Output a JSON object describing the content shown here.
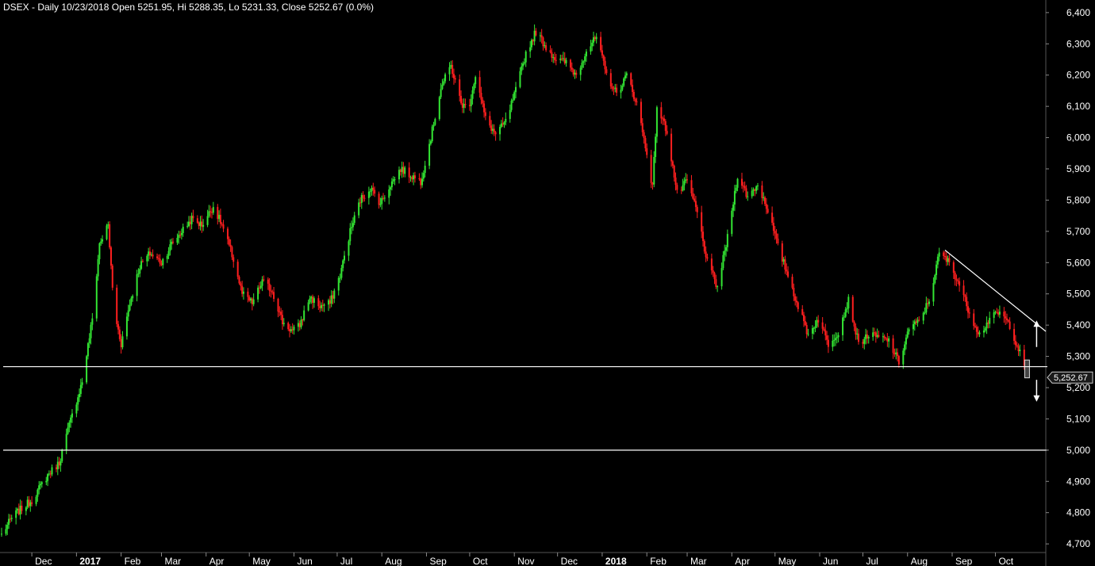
{
  "title": "DSEX - Daily 10/23/2018 Open 5251.95, Hi 5288.35, Lo 5231.33, Close 5252.67 (0.0%)",
  "colors": {
    "background": "#000000",
    "up_candle": "#33e633",
    "down_candle": "#ff1f1f",
    "lines": "#ffffff",
    "axis_text": "#ffffff"
  },
  "chart_data": {
    "type": "candlestick",
    "symbol": "DSEX",
    "interval": "Daily",
    "last_bar": {
      "date": "10/23/2018",
      "open": 5251.95,
      "high": 5288.35,
      "low": 5231.33,
      "close": 5252.67,
      "change": "0.0%"
    },
    "price_label": "5,252.67",
    "ylim": [
      4680,
      6420
    ],
    "y_ticks": [
      4700,
      4800,
      4900,
      5000,
      5100,
      5200,
      5300,
      5400,
      5500,
      5600,
      5700,
      5800,
      5900,
      6000,
      6100,
      6200,
      6300,
      6400
    ],
    "y_tick_labels": [
      "4,700",
      "4,800",
      "4,900",
      "5,000",
      "5,100",
      "5,200",
      "5,300",
      "5,400",
      "5,500",
      "5,600",
      "5,700",
      "5,800",
      "5,900",
      "6,000",
      "6,100",
      "6,200",
      "6,300",
      "6,400"
    ],
    "x_range": [
      "2016-11-10",
      "2018-11-05"
    ],
    "x_labels": [
      {
        "label": "Dec",
        "date": "2016-12-01",
        "bold": false
      },
      {
        "label": "2017",
        "date": "2017-01-01",
        "bold": true
      },
      {
        "label": "Feb",
        "date": "2017-02-01",
        "bold": false
      },
      {
        "label": "Mar",
        "date": "2017-03-01",
        "bold": false
      },
      {
        "label": "Apr",
        "date": "2017-04-01",
        "bold": false
      },
      {
        "label": "May",
        "date": "2017-05-01",
        "bold": false
      },
      {
        "label": "Jun",
        "date": "2017-06-01",
        "bold": false
      },
      {
        "label": "Jul",
        "date": "2017-07-01",
        "bold": false
      },
      {
        "label": "Aug",
        "date": "2017-08-01",
        "bold": false
      },
      {
        "label": "Sep",
        "date": "2017-09-01",
        "bold": false
      },
      {
        "label": "Oct",
        "date": "2017-10-01",
        "bold": false
      },
      {
        "label": "Nov",
        "date": "2017-11-01",
        "bold": false
      },
      {
        "label": "Dec",
        "date": "2017-12-01",
        "bold": false
      },
      {
        "label": "2018",
        "date": "2018-01-01",
        "bold": true
      },
      {
        "label": "Feb",
        "date": "2018-02-01",
        "bold": false
      },
      {
        "label": "Mar",
        "date": "2018-03-01",
        "bold": false
      },
      {
        "label": "Apr",
        "date": "2018-04-01",
        "bold": false
      },
      {
        "label": "May",
        "date": "2018-05-01",
        "bold": false
      },
      {
        "label": "Jun",
        "date": "2018-06-01",
        "bold": false
      },
      {
        "label": "Jul",
        "date": "2018-07-01",
        "bold": false
      },
      {
        "label": "Aug",
        "date": "2018-08-01",
        "bold": false
      },
      {
        "label": "Sep",
        "date": "2018-09-01",
        "bold": false
      },
      {
        "label": "Oct",
        "date": "2018-10-01",
        "bold": false
      }
    ],
    "close_path": [
      [
        "2016-11-10",
        4730
      ],
      [
        "2016-11-18",
        4790
      ],
      [
        "2016-12-01",
        4840
      ],
      [
        "2016-12-12",
        4920
      ],
      [
        "2016-12-20",
        4960
      ],
      [
        "2016-12-27",
        5080
      ],
      [
        "2017-01-05",
        5220
      ],
      [
        "2017-01-12",
        5420
      ],
      [
        "2017-01-17",
        5660
      ],
      [
        "2017-01-23",
        5720
      ],
      [
        "2017-01-27",
        5450
      ],
      [
        "2017-02-01",
        5340
      ],
      [
        "2017-02-07",
        5470
      ],
      [
        "2017-02-14",
        5590
      ],
      [
        "2017-02-21",
        5630
      ],
      [
        "2017-03-01",
        5600
      ],
      [
        "2017-03-08",
        5660
      ],
      [
        "2017-03-15",
        5700
      ],
      [
        "2017-03-22",
        5740
      ],
      [
        "2017-03-29",
        5720
      ],
      [
        "2017-04-06",
        5780
      ],
      [
        "2017-04-12",
        5720
      ],
      [
        "2017-04-20",
        5610
      ],
      [
        "2017-04-26",
        5500
      ],
      [
        "2017-05-03",
        5470
      ],
      [
        "2017-05-10",
        5540
      ],
      [
        "2017-05-17",
        5510
      ],
      [
        "2017-05-24",
        5410
      ],
      [
        "2017-05-31",
        5380
      ],
      [
        "2017-06-05",
        5400
      ],
      [
        "2017-06-12",
        5490
      ],
      [
        "2017-06-19",
        5460
      ],
      [
        "2017-06-26",
        5470
      ],
      [
        "2017-07-03",
        5560
      ],
      [
        "2017-07-10",
        5700
      ],
      [
        "2017-07-17",
        5800
      ],
      [
        "2017-07-24",
        5840
      ],
      [
        "2017-07-31",
        5790
      ],
      [
        "2017-08-07",
        5850
      ],
      [
        "2017-08-14",
        5900
      ],
      [
        "2017-08-21",
        5880
      ],
      [
        "2017-08-28",
        5860
      ],
      [
        "2017-09-04",
        6000
      ],
      [
        "2017-09-11",
        6160
      ],
      [
        "2017-09-18",
        6230
      ],
      [
        "2017-09-25",
        6110
      ],
      [
        "2017-09-30",
        6090
      ],
      [
        "2017-10-05",
        6200
      ],
      [
        "2017-10-12",
        6060
      ],
      [
        "2017-10-19",
        6010
      ],
      [
        "2017-10-26",
        6050
      ],
      [
        "2017-11-02",
        6150
      ],
      [
        "2017-11-09",
        6270
      ],
      [
        "2017-11-16",
        6340
      ],
      [
        "2017-11-23",
        6290
      ],
      [
        "2017-11-30",
        6250
      ],
      [
        "2017-12-07",
        6240
      ],
      [
        "2017-12-14",
        6200
      ],
      [
        "2017-12-21",
        6280
      ],
      [
        "2017-12-28",
        6320
      ],
      [
        "2018-01-04",
        6200
      ],
      [
        "2018-01-11",
        6140
      ],
      [
        "2018-01-18",
        6200
      ],
      [
        "2018-01-25",
        6110
      ],
      [
        "2018-02-01",
        5950
      ],
      [
        "2018-02-05",
        5840
      ],
      [
        "2018-02-08",
        6100
      ],
      [
        "2018-02-15",
        6020
      ],
      [
        "2018-02-22",
        5820
      ],
      [
        "2018-03-01",
        5860
      ],
      [
        "2018-03-08",
        5760
      ],
      [
        "2018-03-15",
        5600
      ],
      [
        "2018-03-22",
        5520
      ],
      [
        "2018-03-29",
        5680
      ],
      [
        "2018-04-05",
        5880
      ],
      [
        "2018-04-12",
        5810
      ],
      [
        "2018-04-19",
        5850
      ],
      [
        "2018-04-26",
        5770
      ],
      [
        "2018-05-03",
        5650
      ],
      [
        "2018-05-10",
        5560
      ],
      [
        "2018-05-17",
        5460
      ],
      [
        "2018-05-24",
        5370
      ],
      [
        "2018-05-31",
        5420
      ],
      [
        "2018-06-07",
        5340
      ],
      [
        "2018-06-14",
        5380
      ],
      [
        "2018-06-21",
        5480
      ],
      [
        "2018-06-28",
        5340
      ],
      [
        "2018-07-05",
        5370
      ],
      [
        "2018-07-12",
        5360
      ],
      [
        "2018-07-19",
        5350
      ],
      [
        "2018-07-26",
        5280
      ],
      [
        "2018-08-02",
        5390
      ],
      [
        "2018-08-09",
        5410
      ],
      [
        "2018-08-16",
        5480
      ],
      [
        "2018-08-23",
        5630
      ],
      [
        "2018-08-30",
        5600
      ],
      [
        "2018-09-06",
        5530
      ],
      [
        "2018-09-13",
        5440
      ],
      [
        "2018-09-20",
        5370
      ],
      [
        "2018-09-27",
        5420
      ],
      [
        "2018-10-04",
        5440
      ],
      [
        "2018-10-11",
        5400
      ],
      [
        "2018-10-18",
        5310
      ],
      [
        "2018-10-23",
        5252
      ]
    ],
    "horizontal_lines": [
      5267,
      5000
    ],
    "trendline": [
      [
        "2018-08-27",
        5640
      ],
      [
        "2018-11-05",
        5380
      ]
    ]
  }
}
